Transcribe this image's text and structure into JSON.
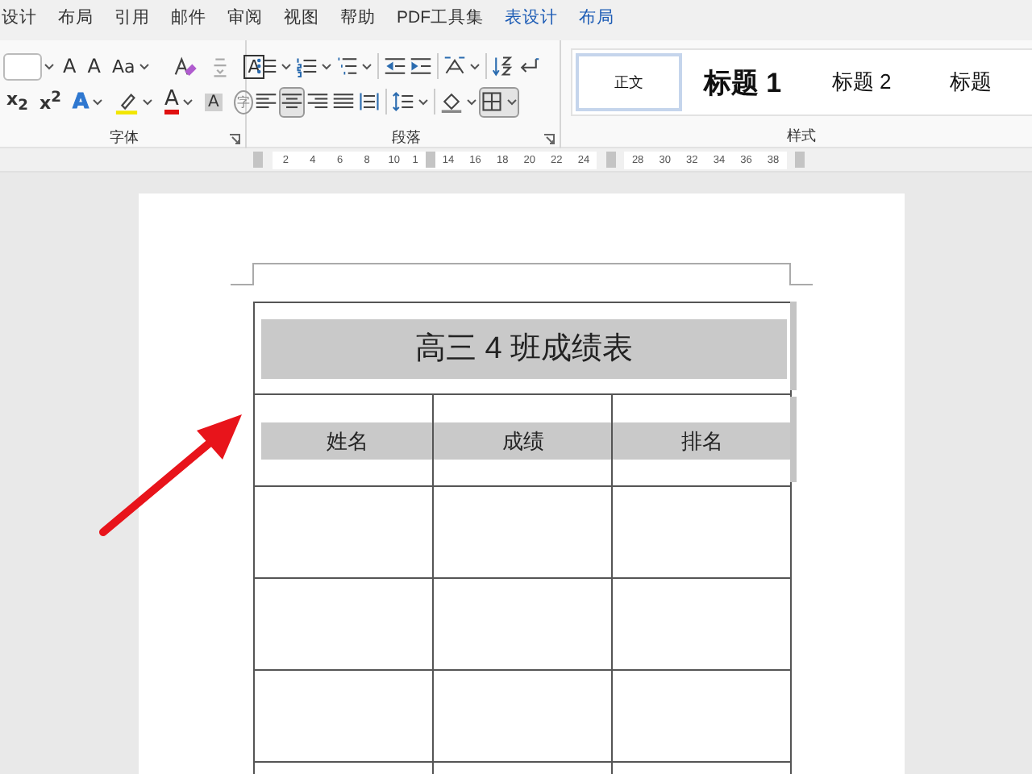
{
  "menu_tabs": [
    {
      "label": "设计",
      "selected": false,
      "contextual": false
    },
    {
      "label": "布局",
      "selected": false,
      "contextual": false
    },
    {
      "label": "引用",
      "selected": false,
      "contextual": false
    },
    {
      "label": "邮件",
      "selected": false,
      "contextual": false
    },
    {
      "label": "审阅",
      "selected": false,
      "contextual": false
    },
    {
      "label": "视图",
      "selected": false,
      "contextual": false
    },
    {
      "label": "帮助",
      "selected": false,
      "contextual": false
    },
    {
      "label": "PDF工具集",
      "selected": false,
      "contextual": false
    },
    {
      "label": "表设计",
      "selected": false,
      "contextual": true
    },
    {
      "label": "布局",
      "selected": false,
      "contextual": true
    }
  ],
  "font_group": {
    "label": "字体",
    "row1": [
      {
        "kind": "size-field",
        "dropdown": true
      },
      {
        "kind": "grow",
        "text": "A",
        "dropdown": false
      },
      {
        "kind": "shrink",
        "text": "A",
        "dropdown": false
      },
      {
        "kind": "case",
        "text": "Aa",
        "dropdown": true
      },
      {
        "kind": "divider"
      },
      {
        "kind": "clear",
        "dropdown": false
      },
      {
        "kind": "phonetic",
        "dropdown": false
      },
      {
        "kind": "border",
        "text": "A",
        "dropdown": false
      }
    ],
    "row2": [
      {
        "kind": "plain",
        "text": "x$_{2}$",
        "dropdown": false
      },
      {
        "kind": "plain",
        "text": "x$^{2}$",
        "dropdown": false
      },
      {
        "kind": "effect",
        "text": "A",
        "dropdown": true
      },
      {
        "kind": "highlight",
        "dropdown": true
      },
      {
        "kind": "color",
        "text": "A",
        "dropdown": true
      },
      {
        "kind": "shade",
        "text": "A",
        "dropdown": false
      },
      {
        "kind": "enclose",
        "text": "字",
        "dropdown": false
      }
    ]
  },
  "paragraph_group": {
    "label": "段落",
    "row1": [
      {
        "kind": "bullets",
        "dropdown": true,
        "selected": false
      },
      {
        "kind": "numbering",
        "dropdown": true,
        "selected": false
      },
      {
        "kind": "multilevel",
        "dropdown": true,
        "selected": false
      },
      {
        "kind": "divider"
      },
      {
        "kind": "outdent",
        "dropdown": false,
        "selected": false
      },
      {
        "kind": "indent",
        "dropdown": false,
        "selected": false
      },
      {
        "kind": "divider"
      },
      {
        "kind": "layout",
        "dropdown": true,
        "selected": false
      },
      {
        "kind": "divider"
      },
      {
        "kind": "sort",
        "dropdown": false,
        "selected": false
      },
      {
        "kind": "marks",
        "dropdown": false,
        "selected": false
      }
    ],
    "row2": [
      {
        "kind": "left",
        "dropdown": false,
        "selected": false
      },
      {
        "kind": "center",
        "dropdown": false,
        "selected": true
      },
      {
        "kind": "right",
        "dropdown": false,
        "selected": false
      },
      {
        "kind": "justify",
        "dropdown": false,
        "selected": false
      },
      {
        "kind": "distribute",
        "dropdown": false,
        "selected": false
      },
      {
        "kind": "divider"
      },
      {
        "kind": "spacing",
        "dropdown": true,
        "selected": false
      },
      {
        "kind": "divider"
      },
      {
        "kind": "shading",
        "dropdown": true,
        "selected": false
      },
      {
        "kind": "borders",
        "dropdown": true,
        "selected": true
      }
    ]
  },
  "styles_group": {
    "label": "样式",
    "styles": [
      {
        "label": "正文",
        "kind": "normal",
        "selected": true
      },
      {
        "label": "标题 1",
        "kind": "heading1",
        "selected": false
      },
      {
        "label": "标题 2",
        "kind": "heading2",
        "selected": false
      },
      {
        "label": "标题",
        "kind": "heading2",
        "selected": false
      }
    ]
  },
  "ruler": [
    {
      "kind": "marker"
    },
    {
      "kind": "number",
      "text": "2"
    },
    {
      "kind": "number",
      "text": "4"
    },
    {
      "kind": "number",
      "text": "6"
    },
    {
      "kind": "number",
      "text": "8"
    },
    {
      "kind": "number",
      "text": "10"
    },
    {
      "kind": "covered",
      "text": "1"
    },
    {
      "kind": "number",
      "text": "14"
    },
    {
      "kind": "number",
      "text": "16"
    },
    {
      "kind": "number",
      "text": "18"
    },
    {
      "kind": "number",
      "text": "20"
    },
    {
      "kind": "number",
      "text": "22"
    },
    {
      "kind": "number",
      "text": "24"
    },
    {
      "kind": "marker"
    },
    {
      "kind": "number",
      "text": "28"
    },
    {
      "kind": "number",
      "text": "30"
    },
    {
      "kind": "number",
      "text": "32"
    },
    {
      "kind": "number",
      "text": "34"
    },
    {
      "kind": "number",
      "text": "36"
    },
    {
      "kind": "number",
      "text": "38"
    },
    {
      "kind": "marker"
    }
  ],
  "table": {
    "title": "高三 4 班成绩表",
    "columns": [
      "姓名",
      "成绩",
      "排名"
    ],
    "rows": [
      {
        "kind": "blank"
      },
      {
        "kind": "blank"
      },
      {
        "kind": "blank"
      },
      {
        "kind": "blank"
      }
    ]
  }
}
